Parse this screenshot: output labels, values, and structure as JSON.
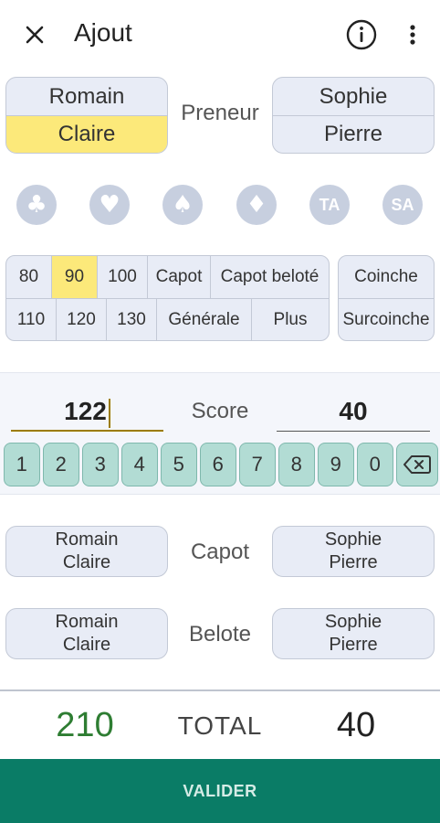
{
  "appbar": {
    "title": "Ajout",
    "close_icon": "close-icon",
    "info_icon": "info-icon",
    "more_icon": "more-vert-icon"
  },
  "preneur": {
    "label": "Preneur",
    "team1": {
      "top": "Romain",
      "bottom": "Claire",
      "selected": "bottom"
    },
    "team2": {
      "top": "Sophie",
      "bottom": "Pierre"
    }
  },
  "suits": [
    {
      "name": "clubs",
      "glyph": "♣"
    },
    {
      "name": "hearts",
      "glyph": "♥"
    },
    {
      "name": "spades",
      "glyph": "♠"
    },
    {
      "name": "diamonds",
      "glyph": "♦"
    },
    {
      "name": "tout-atout",
      "glyph": "TA"
    },
    {
      "name": "sans-atout",
      "glyph": "SA"
    }
  ],
  "bids": {
    "row1": [
      "80",
      "90",
      "100",
      "Capot",
      "Capot beloté"
    ],
    "row2": [
      "110",
      "120",
      "130",
      "Générale",
      "Plus"
    ],
    "selected": "90",
    "coinche": "Coinche",
    "surcoinche": "Surcoinche"
  },
  "score": {
    "label": "Score",
    "left_value": "122",
    "right_value": "40"
  },
  "keypad": [
    "1",
    "2",
    "3",
    "4",
    "5",
    "6",
    "7",
    "8",
    "9",
    "0"
  ],
  "capot": {
    "label": "Capot",
    "team1": [
      "Romain",
      "Claire"
    ],
    "team2": [
      "Sophie",
      "Pierre"
    ]
  },
  "belote": {
    "label": "Belote",
    "team1": [
      "Romain",
      "Claire"
    ],
    "team2": [
      "Sophie",
      "Pierre"
    ]
  },
  "total": {
    "label": "TOTAL",
    "left": "210",
    "right": "40"
  },
  "validate_label": "VALIDER",
  "colors": {
    "accent": "#0a7c66",
    "selected": "#fce97a",
    "keypad": "#b2dcd4",
    "total_left": "#2e7d32"
  }
}
